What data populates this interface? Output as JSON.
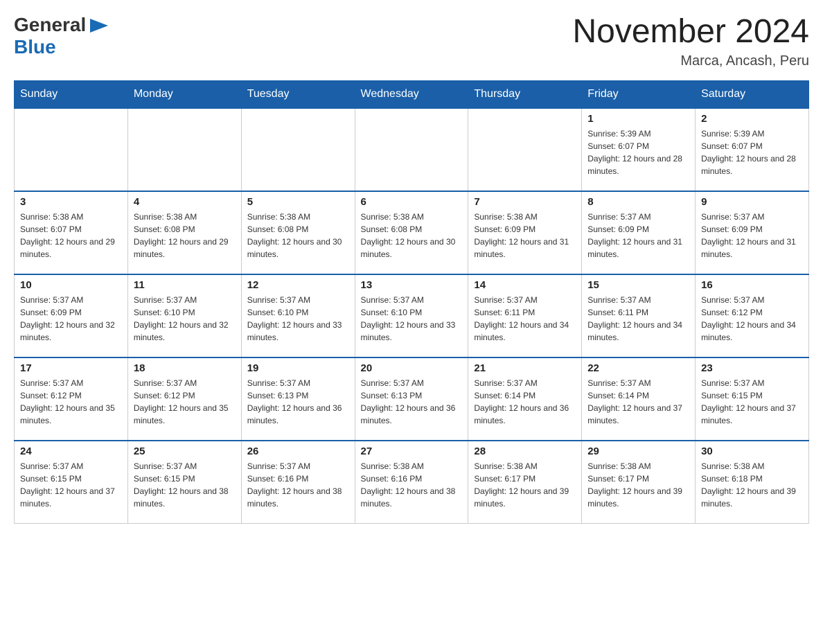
{
  "header": {
    "logo_general": "General",
    "logo_blue": "Blue",
    "month_title": "November 2024",
    "location": "Marca, Ancash, Peru"
  },
  "days_of_week": [
    "Sunday",
    "Monday",
    "Tuesday",
    "Wednesday",
    "Thursday",
    "Friday",
    "Saturday"
  ],
  "weeks": [
    [
      {
        "day": "",
        "info": ""
      },
      {
        "day": "",
        "info": ""
      },
      {
        "day": "",
        "info": ""
      },
      {
        "day": "",
        "info": ""
      },
      {
        "day": "",
        "info": ""
      },
      {
        "day": "1",
        "info": "Sunrise: 5:39 AM\nSunset: 6:07 PM\nDaylight: 12 hours and 28 minutes."
      },
      {
        "day": "2",
        "info": "Sunrise: 5:39 AM\nSunset: 6:07 PM\nDaylight: 12 hours and 28 minutes."
      }
    ],
    [
      {
        "day": "3",
        "info": "Sunrise: 5:38 AM\nSunset: 6:07 PM\nDaylight: 12 hours and 29 minutes."
      },
      {
        "day": "4",
        "info": "Sunrise: 5:38 AM\nSunset: 6:08 PM\nDaylight: 12 hours and 29 minutes."
      },
      {
        "day": "5",
        "info": "Sunrise: 5:38 AM\nSunset: 6:08 PM\nDaylight: 12 hours and 30 minutes."
      },
      {
        "day": "6",
        "info": "Sunrise: 5:38 AM\nSunset: 6:08 PM\nDaylight: 12 hours and 30 minutes."
      },
      {
        "day": "7",
        "info": "Sunrise: 5:38 AM\nSunset: 6:09 PM\nDaylight: 12 hours and 31 minutes."
      },
      {
        "day": "8",
        "info": "Sunrise: 5:37 AM\nSunset: 6:09 PM\nDaylight: 12 hours and 31 minutes."
      },
      {
        "day": "9",
        "info": "Sunrise: 5:37 AM\nSunset: 6:09 PM\nDaylight: 12 hours and 31 minutes."
      }
    ],
    [
      {
        "day": "10",
        "info": "Sunrise: 5:37 AM\nSunset: 6:09 PM\nDaylight: 12 hours and 32 minutes."
      },
      {
        "day": "11",
        "info": "Sunrise: 5:37 AM\nSunset: 6:10 PM\nDaylight: 12 hours and 32 minutes."
      },
      {
        "day": "12",
        "info": "Sunrise: 5:37 AM\nSunset: 6:10 PM\nDaylight: 12 hours and 33 minutes."
      },
      {
        "day": "13",
        "info": "Sunrise: 5:37 AM\nSunset: 6:10 PM\nDaylight: 12 hours and 33 minutes."
      },
      {
        "day": "14",
        "info": "Sunrise: 5:37 AM\nSunset: 6:11 PM\nDaylight: 12 hours and 34 minutes."
      },
      {
        "day": "15",
        "info": "Sunrise: 5:37 AM\nSunset: 6:11 PM\nDaylight: 12 hours and 34 minutes."
      },
      {
        "day": "16",
        "info": "Sunrise: 5:37 AM\nSunset: 6:12 PM\nDaylight: 12 hours and 34 minutes."
      }
    ],
    [
      {
        "day": "17",
        "info": "Sunrise: 5:37 AM\nSunset: 6:12 PM\nDaylight: 12 hours and 35 minutes."
      },
      {
        "day": "18",
        "info": "Sunrise: 5:37 AM\nSunset: 6:12 PM\nDaylight: 12 hours and 35 minutes."
      },
      {
        "day": "19",
        "info": "Sunrise: 5:37 AM\nSunset: 6:13 PM\nDaylight: 12 hours and 36 minutes."
      },
      {
        "day": "20",
        "info": "Sunrise: 5:37 AM\nSunset: 6:13 PM\nDaylight: 12 hours and 36 minutes."
      },
      {
        "day": "21",
        "info": "Sunrise: 5:37 AM\nSunset: 6:14 PM\nDaylight: 12 hours and 36 minutes."
      },
      {
        "day": "22",
        "info": "Sunrise: 5:37 AM\nSunset: 6:14 PM\nDaylight: 12 hours and 37 minutes."
      },
      {
        "day": "23",
        "info": "Sunrise: 5:37 AM\nSunset: 6:15 PM\nDaylight: 12 hours and 37 minutes."
      }
    ],
    [
      {
        "day": "24",
        "info": "Sunrise: 5:37 AM\nSunset: 6:15 PM\nDaylight: 12 hours and 37 minutes."
      },
      {
        "day": "25",
        "info": "Sunrise: 5:37 AM\nSunset: 6:15 PM\nDaylight: 12 hours and 38 minutes."
      },
      {
        "day": "26",
        "info": "Sunrise: 5:37 AM\nSunset: 6:16 PM\nDaylight: 12 hours and 38 minutes."
      },
      {
        "day": "27",
        "info": "Sunrise: 5:38 AM\nSunset: 6:16 PM\nDaylight: 12 hours and 38 minutes."
      },
      {
        "day": "28",
        "info": "Sunrise: 5:38 AM\nSunset: 6:17 PM\nDaylight: 12 hours and 39 minutes."
      },
      {
        "day": "29",
        "info": "Sunrise: 5:38 AM\nSunset: 6:17 PM\nDaylight: 12 hours and 39 minutes."
      },
      {
        "day": "30",
        "info": "Sunrise: 5:38 AM\nSunset: 6:18 PM\nDaylight: 12 hours and 39 minutes."
      }
    ]
  ]
}
